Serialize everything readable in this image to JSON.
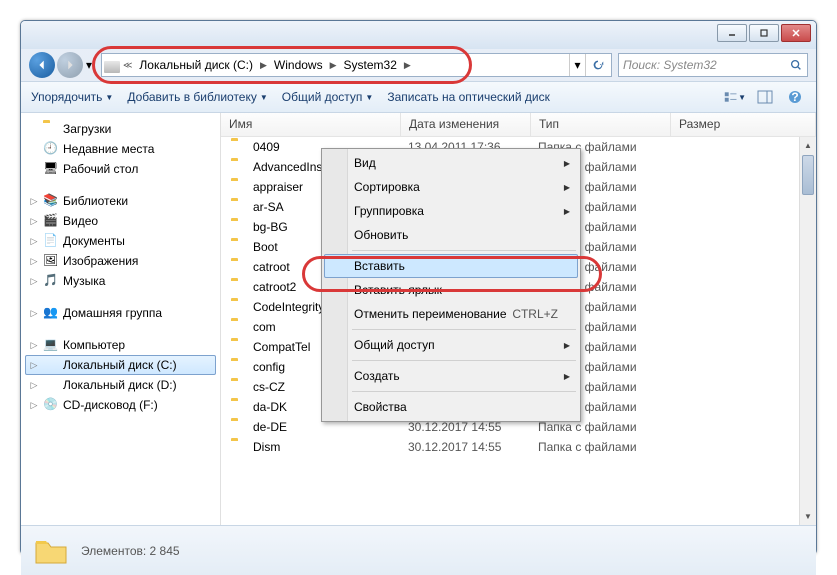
{
  "breadcrumb": {
    "disk": "Локальный диск (C:)",
    "windows": "Windows",
    "system32": "System32"
  },
  "search": {
    "placeholder": "Поиск: System32"
  },
  "toolbar": {
    "organize": "Упорядочить",
    "addlib": "Добавить в библиотеку",
    "share": "Общий доступ",
    "burn": "Записать на оптический диск"
  },
  "columns": {
    "name": "Имя",
    "date": "Дата изменения",
    "type": "Тип",
    "size": "Размер"
  },
  "sidebar": {
    "downloads": "Загрузки",
    "recent": "Недавние места",
    "desktop": "Рабочий стол",
    "libraries": "Библиотеки",
    "video": "Видео",
    "documents": "Документы",
    "pictures": "Изображения",
    "music": "Музыка",
    "homegroup": "Домашняя группа",
    "computer": "Компьютер",
    "diskC": "Локальный диск (C:)",
    "diskD": "Локальный диск (D:)",
    "cdrom": "CD-дисковод (F:)"
  },
  "files": [
    {
      "n": "0409",
      "d": "13.04.2011 17:36",
      "t": "Папка с файлами"
    },
    {
      "n": "AdvancedInstallers",
      "d": "",
      "t": "Папка с файлами"
    },
    {
      "n": "appraiser",
      "d": "",
      "t": "Папка с файлами"
    },
    {
      "n": "ar-SA",
      "d": "",
      "t": "Папка с файлами"
    },
    {
      "n": "bg-BG",
      "d": "",
      "t": "Папка с файлами"
    },
    {
      "n": "Boot",
      "d": "",
      "t": "Папка с файлами"
    },
    {
      "n": "catroot",
      "d": "",
      "t": "Папка с файлами"
    },
    {
      "n": "catroot2",
      "d": "",
      "t": "Папка с файлами"
    },
    {
      "n": "CodeIntegrity",
      "d": "",
      "t": "Папка с файлами"
    },
    {
      "n": "com",
      "d": "",
      "t": "Папка с файлами"
    },
    {
      "n": "CompatTel",
      "d": "",
      "t": "Папка с файлами"
    },
    {
      "n": "config",
      "d": "",
      "t": "Папка с файлами"
    },
    {
      "n": "cs-CZ",
      "d": "",
      "t": "Папка с файлами"
    },
    {
      "n": "da-DK",
      "d": "30.12.2017 14:55",
      "t": "Папка с файлами"
    },
    {
      "n": "de-DE",
      "d": "30.12.2017 14:55",
      "t": "Папка с файлами"
    },
    {
      "n": "Dism",
      "d": "30.12.2017 14:55",
      "t": "Папка с файлами"
    }
  ],
  "context": {
    "view": "Вид",
    "sort": "Сортировка",
    "group": "Группировка",
    "refresh": "Обновить",
    "paste": "Вставить",
    "pasteShortcut": "Вставить ярлык",
    "undoRename": "Отменить переименование",
    "undoKey": "CTRL+Z",
    "share": "Общий доступ",
    "create": "Создать",
    "properties": "Свойства"
  },
  "statusbar": {
    "count": "Элементов: 2 845"
  }
}
